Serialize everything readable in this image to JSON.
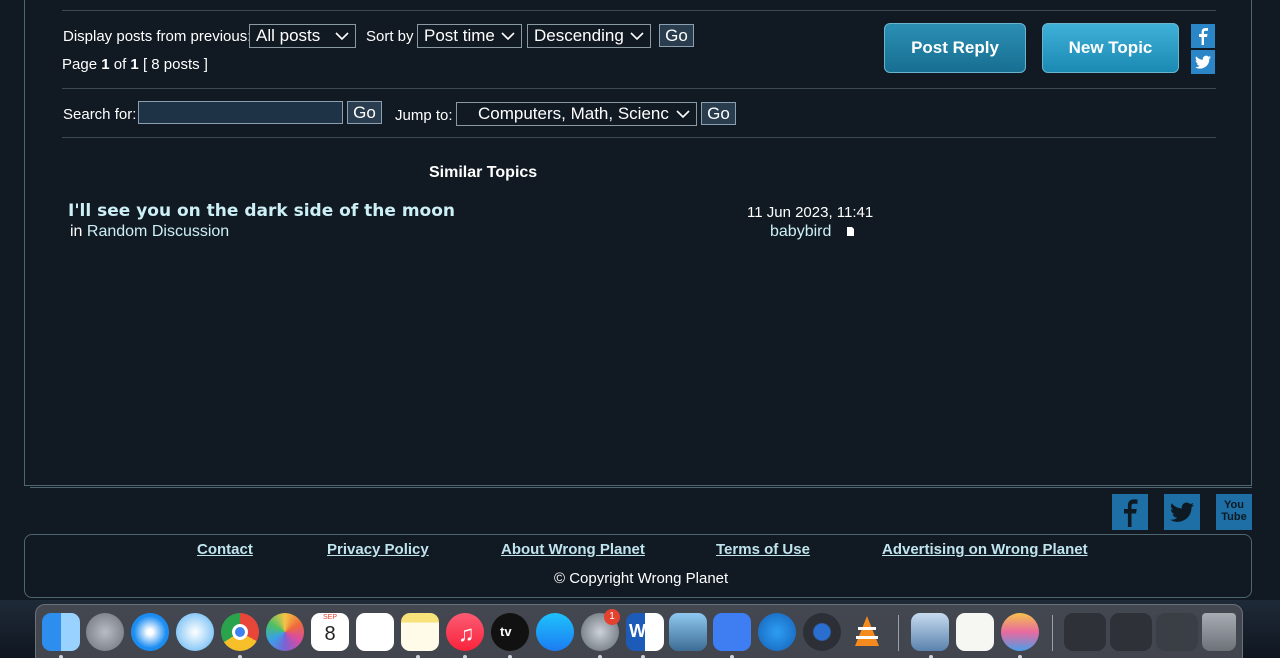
{
  "controls": {
    "display_label": "Display posts from previous:",
    "display_value": "All posts",
    "sortby_label": "Sort by",
    "sort_value": "Post time",
    "order_value": "Descending",
    "go_label": "Go",
    "page_prefix": "Page",
    "page_current": "1",
    "page_of": "of",
    "page_total": "1",
    "posts_count": "[ 8 posts ]"
  },
  "actions": {
    "post_reply": "Post Reply",
    "new_topic": "New Topic"
  },
  "search": {
    "label": "Search for:",
    "value": "",
    "go_label": "Go",
    "jump_label": "Jump to:",
    "jump_value": "Computers, Math, Scienc",
    "jump_go_label": "Go"
  },
  "similar": {
    "heading": "Similar Topics",
    "topics": [
      {
        "title": "I'll see you on the dark side of the moon",
        "in_label": "in",
        "forum": "Random Discussion",
        "date": "11 Jun 2023, 11:41",
        "author": "babybird"
      }
    ]
  },
  "footer": {
    "links": [
      "Contact",
      "Privacy Policy",
      "About Wrong Planet",
      "Terms of Use",
      "Advertising on Wrong Planet"
    ],
    "copyright": "© Copyright Wrong Planet",
    "social": [
      "facebook-icon",
      "twitter-icon",
      "youtube-icon"
    ],
    "youtube_text": "You Tube"
  },
  "dock": {
    "calendar_month": "SEP",
    "calendar_day": "8",
    "tv_label": "tv",
    "badge_count": "1",
    "word_letter": "W",
    "apps": [
      "finder",
      "launchpad",
      "safari",
      "messages",
      "chrome",
      "photos",
      "calendar",
      "reminders",
      "notes",
      "music",
      "apple-tv",
      "app-store",
      "system-preferences",
      "word",
      "preview",
      "nordvpn",
      "frog",
      "quicktime",
      "vlc",
      "mail",
      "textedit",
      "family",
      "screenshots",
      "trash"
    ]
  },
  "colors": {
    "background": "#111922",
    "link": "#cdeff6",
    "button": "#1b8ab2"
  }
}
